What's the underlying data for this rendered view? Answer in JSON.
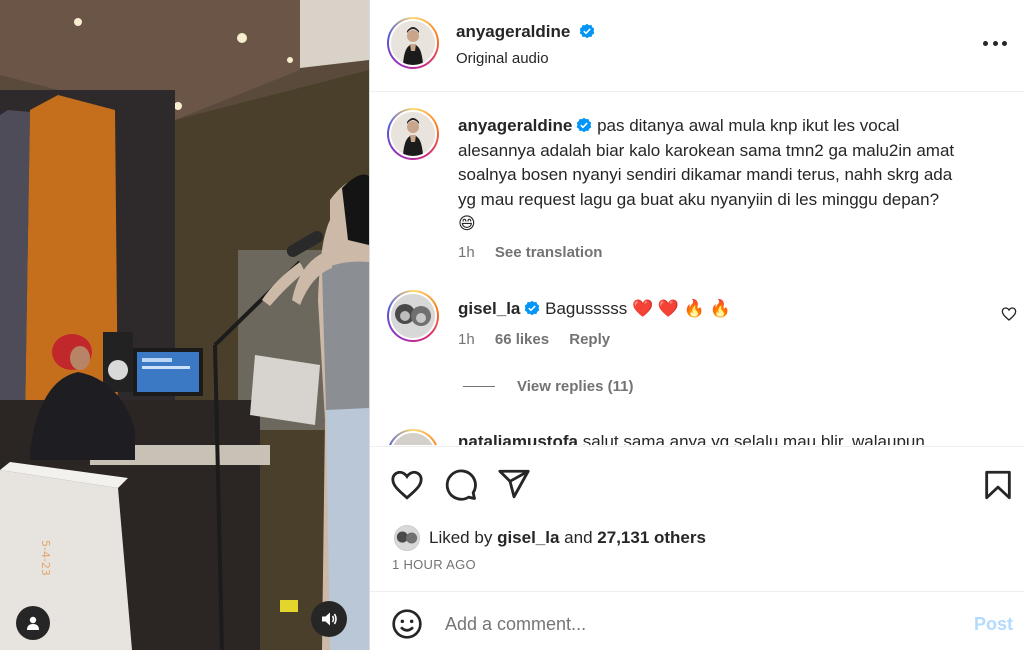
{
  "post": {
    "username": "anyageraldine",
    "subtitle": "Original audio"
  },
  "comments": [
    {
      "username": "anyageraldine",
      "lines": [
        "pas ditanya awal mula knp ikut les vocal",
        "alesannya adalah biar kalo karokean sama tmn2 ga malu2in amat",
        "soalnya bosen nyanyi sendiri dikamar mandi terus, nahh skrg ada",
        "yg mau request lagu ga buat aku nyanyiin di les minggu depan?"
      ],
      "emoji": "😄",
      "time": "1h",
      "see_translation": "See translation"
    },
    {
      "username": "gisel_la",
      "text": "Bagusssss",
      "emoji": "❤️ ❤️ 🔥 🔥",
      "time": "1h",
      "likes": "66 likes",
      "reply": "Reply"
    },
    {
      "username": "nataliamustofa",
      "text": "salut sama anya yg selalu mau blir, walaupun"
    }
  ],
  "view_replies": "View replies (11)",
  "likes": {
    "prefix": "Liked by",
    "user": "gisel_la",
    "and": "and",
    "others": "27,131 others"
  },
  "time_ago": "1 HOUR AGO",
  "add_comment": {
    "placeholder": "Add a comment...",
    "post_label": "Post"
  },
  "icons": {
    "like": "heart-icon",
    "comment": "comment-icon",
    "share": "send-icon",
    "save": "bookmark-icon",
    "emoji": "emoji-icon",
    "more": "more-icon",
    "verified": "verified-badge-icon",
    "user": "user-tag-icon",
    "volume": "volume-icon"
  },
  "colors": {
    "verified": "#0095f6",
    "post_disabled": "#b3dbff",
    "secondary_text": "#737373"
  }
}
